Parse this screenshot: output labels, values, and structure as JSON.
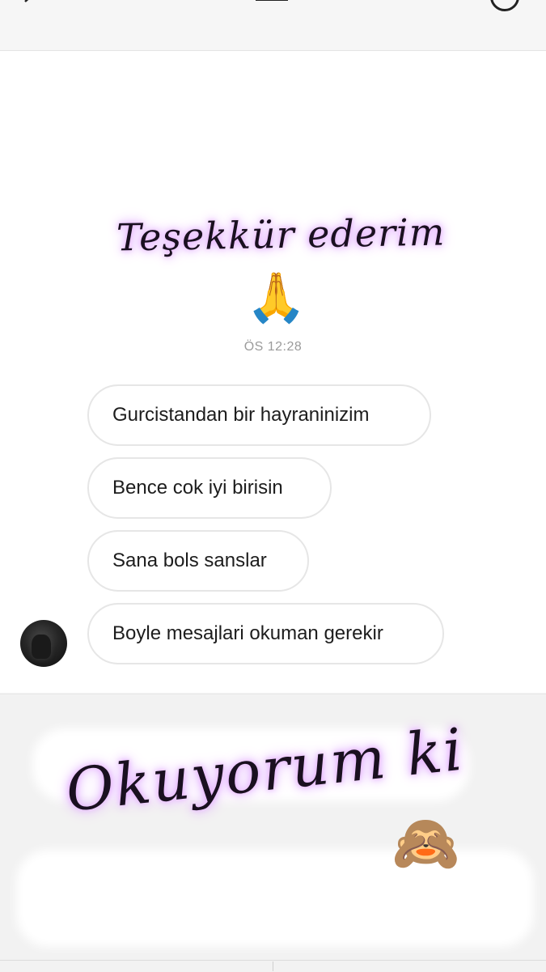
{
  "header": {
    "back_icon": "chevron-left-icon",
    "center_icon": "video-call-icon",
    "info_icon": "info-icon"
  },
  "overlay": {
    "thanks_text": "Teşekkür ederim",
    "thanks_emoji": "🙏",
    "reading_text": "Okuyorum ki",
    "reading_emoji": "🙈"
  },
  "chat": {
    "timestamp": "ÖS 12:28",
    "messages": [
      {
        "text": "Gurcistandan bir hayraninizim"
      },
      {
        "text": "Bence cok iyi birisin"
      },
      {
        "text": "Sana bols sanslar"
      },
      {
        "text": "Boyle mesajlari okuman gerekir"
      }
    ],
    "avatar": "profile-photo"
  },
  "colors": {
    "bubble_border": "#e6e6e6",
    "timestamp": "#9b9b9b",
    "glow": "#dca0ff"
  }
}
